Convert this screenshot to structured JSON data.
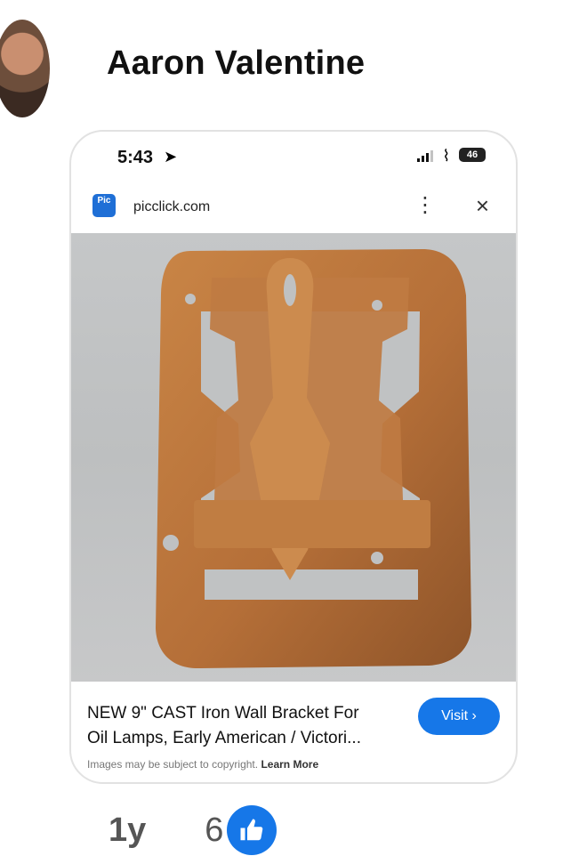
{
  "author": {
    "name": "Aaron Valentine"
  },
  "phone": {
    "time": "5:43",
    "battery": "46"
  },
  "browser": {
    "site_icon_text": "Pic",
    "domain": "picclick.com"
  },
  "result": {
    "title_line1": "NEW 9\" CAST Iron Wall Bracket For",
    "title_line2": "Oil Lamps, Early American / Victori...",
    "visit_label": "Visit ›",
    "copyright_text": "Images may be subject to copyright.",
    "learn_more": "Learn More"
  },
  "meta": {
    "age": "1y",
    "like_count": "6"
  },
  "colors": {
    "accent": "#1677e8",
    "rust": "#b56f38"
  }
}
